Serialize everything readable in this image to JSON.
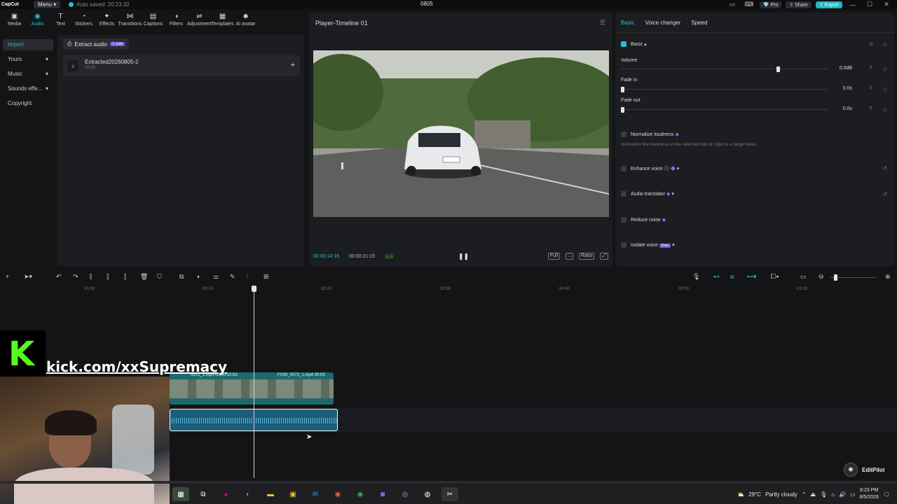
{
  "titlebar": {
    "logo": "CapCut",
    "menu": "Menu",
    "autosave": "Auto saved: 20:23:32",
    "project": "0805",
    "pro": "Pro",
    "share": "Share",
    "export": "Export"
  },
  "toolbar": [
    {
      "label": "Media",
      "icon": "media-icon"
    },
    {
      "label": "Audio",
      "icon": "audio-icon"
    },
    {
      "label": "Text",
      "icon": "text-icon"
    },
    {
      "label": "Stickers",
      "icon": "stickers-icon"
    },
    {
      "label": "Effects",
      "icon": "effects-icon"
    },
    {
      "label": "Transitions",
      "icon": "transitions-icon"
    },
    {
      "label": "Captions",
      "icon": "captions-icon"
    },
    {
      "label": "Filters",
      "icon": "filters-icon"
    },
    {
      "label": "Adjustment",
      "icon": "adjustment-icon"
    },
    {
      "label": "Templates",
      "icon": "templates-icon"
    },
    {
      "label": "AI avatar",
      "icon": "ai-avatar-icon"
    }
  ],
  "leftnav": [
    "Import",
    "Yours",
    "Music",
    "Sounds effe...",
    "Copyright"
  ],
  "media": {
    "extract_label": "Extract audio",
    "extract_badge": "1 use",
    "item_name": "Extracted20260805-2",
    "item_duration": "00:26"
  },
  "player": {
    "title": "Player-Timeline 01",
    "current": "00:00:14:16",
    "total": "00:00:21:15",
    "full": "Full",
    "ratio": "Ratio"
  },
  "right": {
    "tabs": [
      "Basic",
      "Voice changer",
      "Speed"
    ],
    "basic": "Basic",
    "volume_label": "Volume",
    "volume_value": "0.0dB",
    "fadein_label": "Fade in",
    "fadein_value": "0.0s",
    "fadeout_label": "Fade out",
    "fadeout_value": "0.0s",
    "normalize": "Normalize loudness",
    "normalize_desc": "Normalize the loudness of the selected clip or clips to a target level.",
    "enhance": "Enhance voice",
    "translator": "Audio translator",
    "reduce": "Reduce noise",
    "isolate": "Isolate voice",
    "isolate_badge": "Free"
  },
  "ruler": [
    "00:00",
    "00:10",
    "00:20",
    "00:30",
    "00:40",
    "00:50",
    "01:00"
  ],
  "tracks": {
    "clip1_label": "0072_1.mp4   00:00:10:03",
    "clip2_label": "FX30_0072_1.mp4   00:00"
  },
  "overlay": {
    "kick_url": "kick.com/xxSupremacy",
    "editpilot": "EditPilot"
  },
  "taskbar": {
    "weather": "29°C",
    "weather_desc": "Partly cloudy",
    "time": "8:23 PM",
    "date": "8/5/2026"
  }
}
